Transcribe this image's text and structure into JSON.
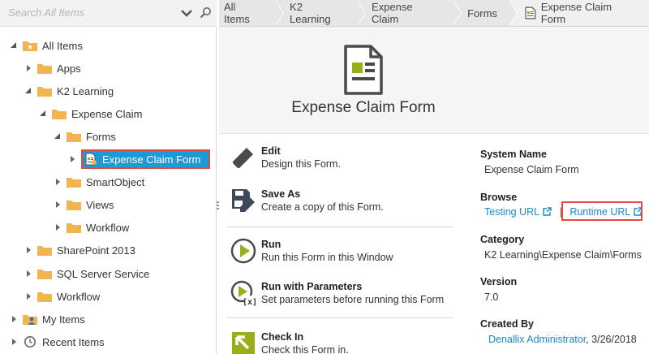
{
  "search": {
    "placeholder": "Search All Items"
  },
  "tree": [
    {
      "label": "All Items",
      "type": "all"
    },
    {
      "label": "Apps",
      "type": "folder"
    },
    {
      "label": "K2 Learning",
      "type": "folder"
    },
    {
      "label": "Expense Claim",
      "type": "folder"
    },
    {
      "label": "Forms",
      "type": "folder"
    },
    {
      "label": "Expense Claim Form",
      "type": "form",
      "selected": true
    },
    {
      "label": "SmartObject",
      "type": "folder"
    },
    {
      "label": "Views",
      "type": "folder"
    },
    {
      "label": "Workflow",
      "type": "folder"
    },
    {
      "label": "SharePoint 2013",
      "type": "folder"
    },
    {
      "label": "SQL Server Service",
      "type": "folder"
    },
    {
      "label": "Workflow",
      "type": "folder"
    },
    {
      "label": "My Items",
      "type": "user"
    },
    {
      "label": "Recent Items",
      "type": "recent"
    }
  ],
  "breadcrumb": [
    "All Items",
    "K2 Learning",
    "Expense Claim",
    "Forms",
    "Expense Claim Form"
  ],
  "header": {
    "title": "Expense Claim Form"
  },
  "actions": [
    {
      "title": "Edit",
      "desc": "Design this Form."
    },
    {
      "title": "Save As",
      "desc": "Create a copy of this Form."
    },
    {
      "title": "Run",
      "desc": "Run this Form in this Window"
    },
    {
      "title": "Run with Parameters",
      "desc": "Set parameters before running this Form"
    },
    {
      "title": "Check In",
      "desc": "Check this Form in."
    }
  ],
  "properties": {
    "system_name_label": "System Name",
    "system_name": "Expense Claim Form",
    "browse_label": "Browse",
    "testing_url": "Testing URL",
    "separator": "|",
    "runtime_url": "Runtime URL",
    "category_label": "Category",
    "category": "K2 Learning\\Expense Claim\\Forms",
    "version_label": "Version",
    "version": "7.0",
    "created_by_label": "Created By",
    "created_by": "Denallix Administrator",
    "created_date": ", 3/26/2018"
  },
  "colors": {
    "accent": "#1e9ad6",
    "highlight": "#e04a3f",
    "folder": "#f0b550",
    "link": "#1e88c7",
    "run_green": "#9aae1d"
  }
}
